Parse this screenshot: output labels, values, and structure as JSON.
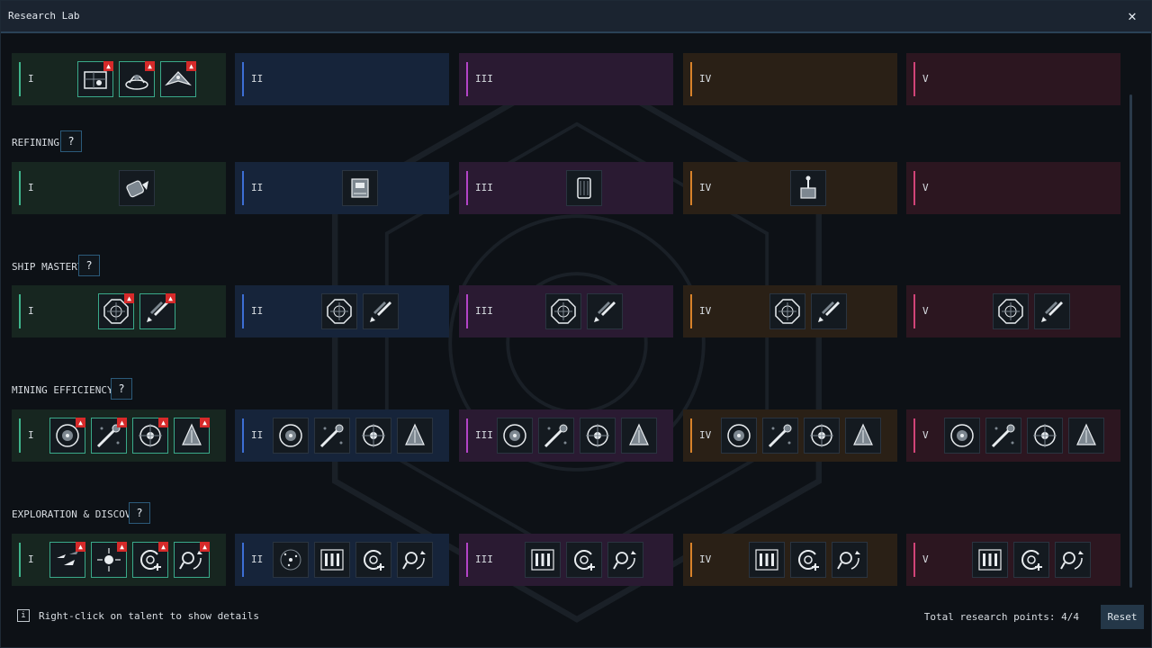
{
  "window": {
    "title": "Research Lab",
    "close_label": "✕"
  },
  "tiers": [
    "I",
    "II",
    "III",
    "IV",
    "V"
  ],
  "sections": [
    {
      "name": "",
      "help": "?",
      "rows": [
        [
          "pipe-grid-icon",
          "dome-reactor-icon",
          "wing-craft-icon"
        ],
        [],
        [],
        [],
        []
      ],
      "active_tier1": true
    },
    {
      "name": "REFINING",
      "help": "?",
      "rows": [
        [
          "drill-cylinder-icon"
        ],
        [
          "press-machine-icon"
        ],
        [
          "canister-icon"
        ],
        [
          "fountain-machine-icon"
        ],
        []
      ],
      "active_tier1": false
    },
    {
      "name": "SHIP MASTERY",
      "help": "?",
      "rows": [
        [
          "octagon-compass-icon",
          "rocket-thrust-icon"
        ],
        [
          "octagon-compass-icon",
          "rocket-thrust-icon"
        ],
        [
          "octagon-compass-icon",
          "rocket-thrust-icon"
        ],
        [
          "octagon-compass-icon",
          "rocket-thrust-icon"
        ],
        [
          "octagon-compass-icon",
          "rocket-thrust-icon"
        ]
      ],
      "active_tier1": true
    },
    {
      "name": "MINING EFFICIENCY",
      "help": "?",
      "rows": [
        [
          "core-sphere-icon",
          "laser-beam-icon",
          "target-wheel-icon",
          "drill-head-icon"
        ],
        [
          "core-sphere-icon",
          "laser-beam-icon",
          "target-wheel-icon",
          "drill-head-icon"
        ],
        [
          "core-sphere-icon",
          "laser-beam-icon",
          "target-wheel-icon",
          "drill-head-icon"
        ],
        [
          "core-sphere-icon",
          "laser-beam-icon",
          "target-wheel-icon",
          "drill-head-icon"
        ],
        [
          "core-sphere-icon",
          "laser-beam-icon",
          "target-wheel-icon",
          "drill-head-icon"
        ]
      ],
      "active_tier1": true
    },
    {
      "name": "EXPLORATION & DISCOVERY",
      "help": "?",
      "rows": [
        [
          "ship-fleet-icon",
          "star-burst-icon",
          "radar-plus-icon",
          "scan-arrow-icon"
        ],
        [
          "star-map-icon",
          "rocket-bay-icon",
          "radar-plus-icon",
          "scan-arrow-icon"
        ],
        [
          "rocket-bay-icon",
          "radar-plus-icon",
          "scan-arrow-icon"
        ],
        [
          "rocket-bay-icon",
          "radar-plus-icon",
          "scan-arrow-icon"
        ],
        [
          "rocket-bay-icon",
          "radar-plus-icon",
          "scan-arrow-icon"
        ]
      ],
      "active_tier1": true
    }
  ],
  "badge": "▲",
  "footer": {
    "info_icon": "i",
    "hint": "Right-click on talent to show details",
    "points_label": "Total research points:",
    "points_value": "4/4",
    "reset_label": "Reset"
  }
}
